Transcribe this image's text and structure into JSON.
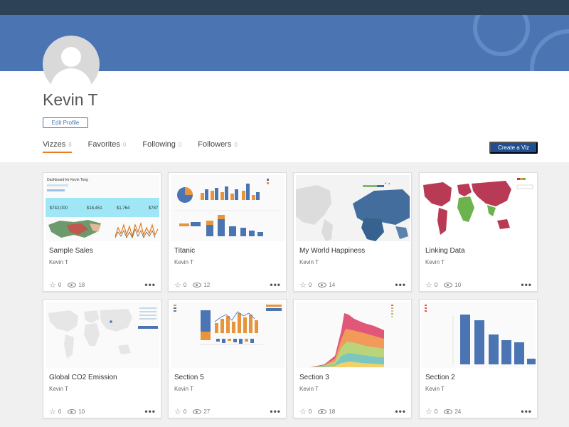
{
  "profile": {
    "name": "Kevin T",
    "edit_label": "Edit Profile"
  },
  "tabs": [
    {
      "label": "Vizzes",
      "count": "8"
    },
    {
      "label": "Favorites",
      "count": "0"
    },
    {
      "label": "Following",
      "count": "0"
    },
    {
      "label": "Followers",
      "count": "0"
    }
  ],
  "create_label": "Create a Viz",
  "cards": [
    {
      "title": "Sample Sales",
      "author": "Kevin T",
      "favorites": "0",
      "views": "18",
      "thumb_text": [
        "Dashboard for Kevin Tong",
        "$742,000",
        "$18,451",
        "$1,764",
        "$787"
      ]
    },
    {
      "title": "Titanic",
      "author": "Kevin T",
      "favorites": "0",
      "views": "12"
    },
    {
      "title": "My World Happiness",
      "author": "Kevin T",
      "favorites": "0",
      "views": "14"
    },
    {
      "title": "Linking Data",
      "author": "Kevin T",
      "favorites": "0",
      "views": "10"
    },
    {
      "title": "Global CO2 Emission",
      "author": "Kevin T",
      "favorites": "0",
      "views": "10"
    },
    {
      "title": "Section 5",
      "author": "Kevin T",
      "favorites": "0",
      "views": "27"
    },
    {
      "title": "Section 3",
      "author": "Kevin T",
      "favorites": "0",
      "views": "18"
    },
    {
      "title": "Section 2",
      "author": "Kevin T",
      "favorites": "0",
      "views": "24"
    }
  ],
  "colors": {
    "topbar": "#2e4257",
    "banner": "#4b74b3",
    "accent": "#e57e25",
    "button": "#1f4f91"
  }
}
